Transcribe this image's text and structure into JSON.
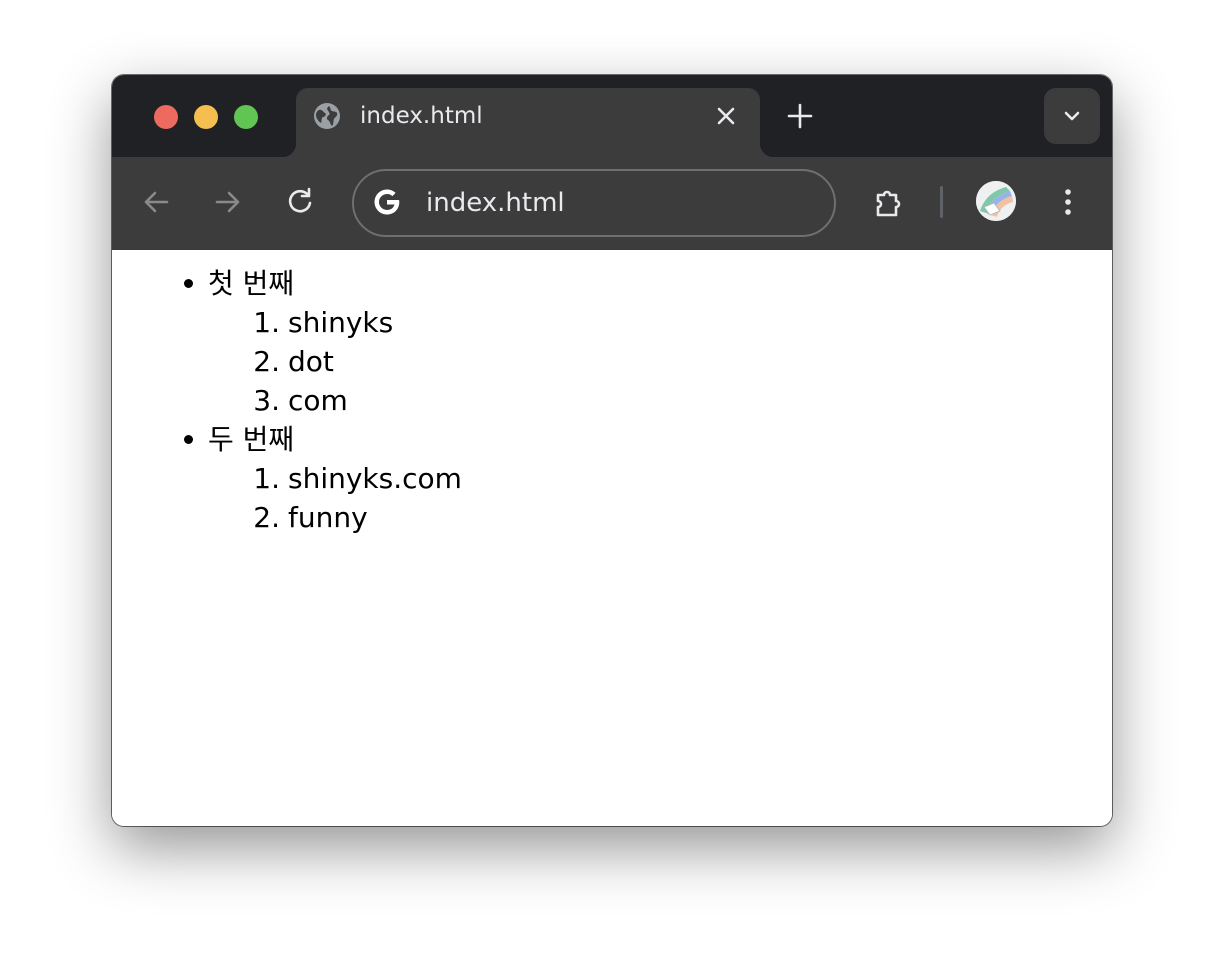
{
  "window": {
    "tab_title": "index.html",
    "address": "index.html"
  },
  "toolbar": {
    "back_icon": "arrow-left-icon",
    "forward_icon": "arrow-right-icon",
    "reload_icon": "reload-icon",
    "extensions_icon": "puzzle-icon",
    "menu_icon": "kebab-menu-icon"
  },
  "colors": {
    "titlebar": "#202124",
    "toolbar": "#3c3c3c",
    "text_light": "#e8eaed",
    "close": "#ed6a5e",
    "minimize": "#f4bf4f",
    "zoom": "#61c554"
  },
  "page": {
    "list": [
      {
        "label": "첫 번째",
        "items": [
          {
            "num": "1.",
            "text": "shinyks"
          },
          {
            "num": "2.",
            "text": "dot"
          },
          {
            "num": "3.",
            "text": "com"
          }
        ]
      },
      {
        "label": "두 번째",
        "items": [
          {
            "num": "1.",
            "text": "shinyks.com"
          },
          {
            "num": "2.",
            "text": "funny"
          }
        ]
      }
    ]
  }
}
